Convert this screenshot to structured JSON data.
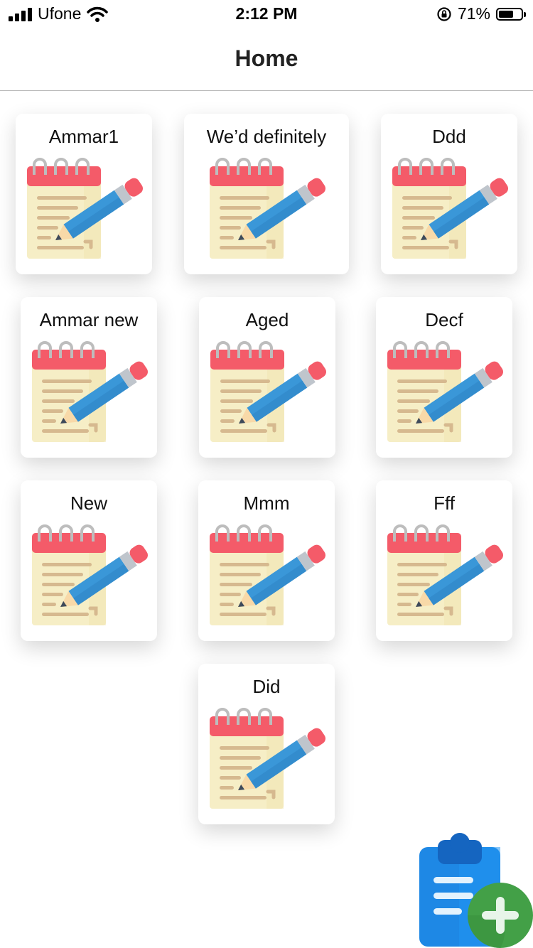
{
  "status_bar": {
    "carrier": "Ufone",
    "time": "2:12 PM",
    "battery_percent": "71%",
    "battery_level": 0.71
  },
  "nav": {
    "title": "Home"
  },
  "notes": [
    {
      "title": "Ammar1"
    },
    {
      "title": "We’d definitely"
    },
    {
      "title": "Ddd"
    },
    {
      "title": "Ammar new"
    },
    {
      "title": "Aged"
    },
    {
      "title": "Decf"
    },
    {
      "title": "New"
    },
    {
      "title": "Mmm"
    },
    {
      "title": "Fff"
    },
    {
      "title": "Did"
    }
  ],
  "icons": {
    "note": "notepad-pencil-icon",
    "add": "clipboard-add-icon"
  },
  "colors": {
    "notepad_header": "#F45B69",
    "notepad_paper": "#F6EEC6",
    "pencil_body": "#3A97D8",
    "fab_clipboard": "#1E88E5",
    "fab_plus_circle": "#43A047"
  }
}
